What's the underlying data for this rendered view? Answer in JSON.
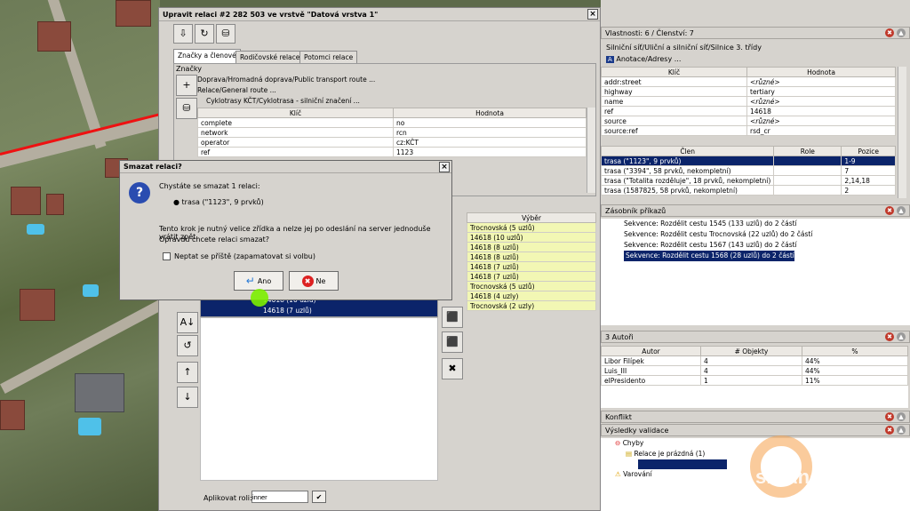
{
  "relation_editor": {
    "title": "Upravit relaci #2 282 503 ve vrstvě \"Datová vrstva 1\"",
    "close": "×",
    "tabs": [
      "Značky a členové",
      "Rodičovské relace",
      "Potomci relace"
    ],
    "tags_header": "Značky",
    "presets": [
      "Doprava/Hromadná doprava/Public transport route ...",
      "Relace/General route ...",
      "Cyklotrasy KČT/Cyklotrasa - silniční značení ..."
    ],
    "tag_columns": [
      "Klíč",
      "Hodnota"
    ],
    "tags": [
      {
        "k": "complete",
        "v": "no"
      },
      {
        "k": "network",
        "v": "rcn"
      },
      {
        "k": "operator",
        "v": "cz:KČT"
      },
      {
        "k": "ref",
        "v": "1123"
      }
    ],
    "members_selected": [
      "14618 (10 uzlů)",
      "14618 (7 uzlů)"
    ],
    "selection_header": "Výběr",
    "selection": [
      "Trocnovská (5 uzlů)",
      "14618 (10 uzlů)",
      "14618 (8 uzlů)",
      "14618 (8 uzlů)",
      "14618 (7 uzlů)",
      "14618 (7 uzlů)",
      "Trocnovská (5 uzlů)",
      "14618 (4 uzly)",
      "Trocnovská (2 uzly)"
    ],
    "apply_role_label": "Aplikovat roli:",
    "apply_role_value": "inner"
  },
  "dialog": {
    "title": "Smazat relaci?",
    "close": "×",
    "question": "Chystáte se smazat 1 relaci:",
    "item": "trasa (\"1123\", 9 prvků)",
    "warning_line1": "Tento krok je nutný velice zřídka a nelze jej po odeslání na server jednoduše vrátit zpět.",
    "warning_line2": "Opravdu chcete relaci smazat?",
    "checkbox_label": "Neptat se příště (zapamatovat si volbu)",
    "yes": "Ano",
    "no": "Ne"
  },
  "properties": {
    "title": "Vlastnosti: 6 / Členství: 7",
    "preset1": "Silniční síť/Uliční a silniční síť/Silnice 3. třídy",
    "preset2": "Anotace/Adresy ...",
    "columns": [
      "Klíč",
      "Hodnota"
    ],
    "rows": [
      {
        "k": "addr:street",
        "v": "<různé>"
      },
      {
        "k": "highway",
        "v": "tertiary"
      },
      {
        "k": "name",
        "v": "<různé>"
      },
      {
        "k": "ref",
        "v": "14618"
      },
      {
        "k": "source",
        "v": "<různé>"
      },
      {
        "k": "source:ref",
        "v": "rsd_cr"
      }
    ],
    "member_columns": [
      "Člen",
      "Role",
      "Pozice"
    ],
    "members": [
      {
        "c": "trasa (\"1123\", 9 prvků)",
        "r": "",
        "p": "1-9"
      },
      {
        "c": "trasa (\"3394\", 58 prvků, nekompletní)",
        "r": "",
        "p": "7"
      },
      {
        "c": "trasa (\"Totalita rozděluje\", 18 prvků, nekompletní)",
        "r": "",
        "p": "2,14,18"
      },
      {
        "c": "trasa (1587825, 58 prvků, nekompletní)",
        "r": "",
        "p": "2"
      }
    ]
  },
  "commands": {
    "title": "Zásobník příkazů",
    "items": [
      "Sekvence: Rozdělit cestu 1545 (133 uzlů) do 2 částí",
      "Sekvence: Rozdělit cestu Trocnovská (22 uzlů) do 2 částí",
      "Sekvence: Rozdělit cestu 1567 (143 uzlů) do 2 částí",
      "Sekvence: Rozdělit cestu 1568 (28 uzlů) do 2 částí"
    ]
  },
  "authors": {
    "title": "3 Autoři",
    "columns": [
      "Autor",
      "# Objekty",
      "%"
    ],
    "rows": [
      {
        "a": "Libor Filípek",
        "n": "4",
        "p": "44%"
      },
      {
        "a": "Luis_III",
        "n": "4",
        "p": "44%"
      },
      {
        "a": "elPresidento",
        "n": "1",
        "p": "11%"
      }
    ]
  },
  "conflict": {
    "title": "Konflikt"
  },
  "validation": {
    "title": "Výsledky validace",
    "errors": "Chyby",
    "empty_relation": "Relace je prázdná (1)",
    "warnings": "Varování"
  },
  "watermark": "smAnd.cz",
  "colors": {
    "selection": "#0b246a",
    "yellow_row": "#f2f7b4",
    "cursor_highlight": "#7cf000"
  }
}
